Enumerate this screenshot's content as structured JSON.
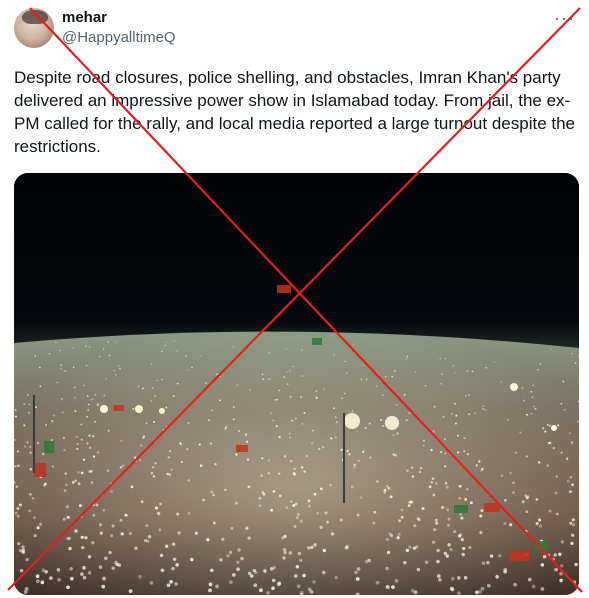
{
  "tweet": {
    "display_name": "mehar",
    "handle": "@HappyalltimeQ",
    "more_label": "···",
    "text": "Despite road closures, police shelling, and obstacles, Imran Khan's party delivered an impressive power show in Islamabad today. From jail, the ex-PM called for the rally, and local media reported a large turnout despite the restrictions."
  },
  "icons": {
    "more": "more-icon",
    "avatar": "avatar"
  },
  "colors": {
    "cross": "#e02020",
    "text": "#0f1419",
    "secondary": "#536471"
  }
}
